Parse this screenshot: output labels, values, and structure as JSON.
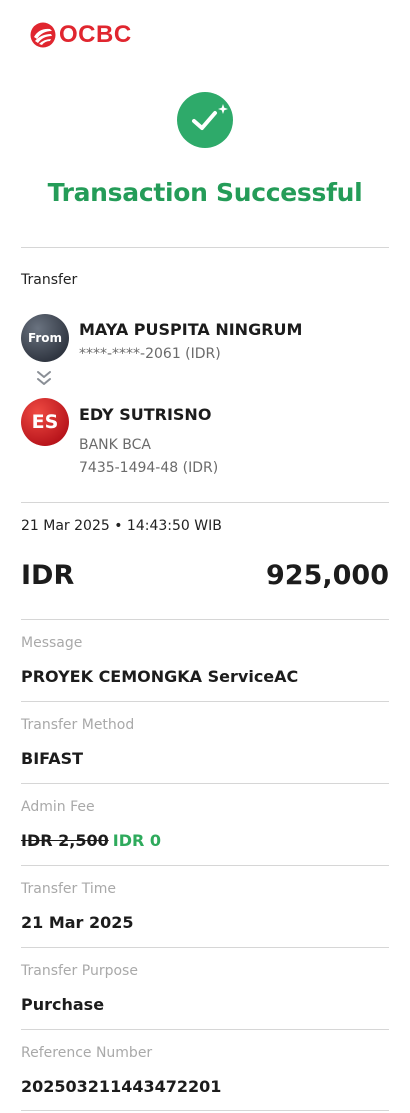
{
  "brand": {
    "name": "OCBC",
    "color": "#e0262f"
  },
  "status": {
    "icon": "check-sparkle-icon",
    "title": "Transaction Successful",
    "color": "#249c58"
  },
  "transfer": {
    "type_label": "Transfer",
    "from": {
      "avatar_label": "From",
      "name": "MAYA PUSPITA NINGRUM",
      "account": "****-****-2061 (IDR)"
    },
    "to": {
      "avatar_label": "ES",
      "name": "EDY SUTRISNO",
      "bank": "BANK BCA",
      "account": "7435-1494-48 (IDR)"
    }
  },
  "datetime": "21 Mar 2025 • 14:43:50 WIB",
  "amount": {
    "currency": "IDR",
    "value": "925,000"
  },
  "details": {
    "message": {
      "label": "Message",
      "value": "PROYEK CEMONGKA ServiceAC"
    },
    "method": {
      "label": "Transfer Method",
      "value": "BIFAST"
    },
    "admin_fee": {
      "label": "Admin Fee",
      "original": "IDR 2,500",
      "final": "IDR 0"
    },
    "time": {
      "label": "Transfer Time",
      "value": "21 Mar 2025"
    },
    "purpose": {
      "label": "Transfer Purpose",
      "value": "Purchase"
    },
    "reference": {
      "label": "Reference Number",
      "value": "20250321144347220​1"
    }
  }
}
